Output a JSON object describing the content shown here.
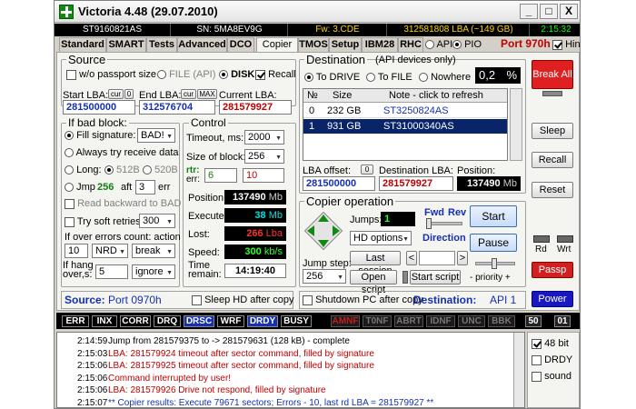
{
  "window": {
    "title": "Victoria 4.48 (29.07.2010)",
    "minimize": "_",
    "maximize": "□",
    "close": "X"
  },
  "info": {
    "model": "ST9160821AS",
    "serial": "SN: 5MA8EV9G",
    "firmware": "Fw: 3.CDE",
    "lba": "312581808 LBA (~149 GB)",
    "time": "2:15:32"
  },
  "tabs": [
    "Standard",
    "SMART",
    "Tests",
    "Advanced",
    "DCO",
    "Copier",
    "TMOS",
    "Setup",
    "IBM28",
    "RHC"
  ],
  "mode": {
    "api": "API",
    "pio": "PIO",
    "port": "Port 970h",
    "hints": "Hints"
  },
  "source": {
    "title": "Source",
    "passport": "w/o passport size",
    "file_api": "FILE (API)",
    "disk": "DISK",
    "recall": "Recall",
    "start_lba_label": "Start LBA:",
    "start_lba_btn": "cur",
    "start_lba_zero": "0",
    "start_lba": "281500000",
    "end_lba_label": "End LBA:",
    "end_lba_btn": "cur",
    "end_lba_max": "MAX",
    "end_lba": "312576704",
    "current_lba_label": "Current LBA:",
    "current_lba": "281579927"
  },
  "badblock": {
    "title": "If bad block:",
    "fill_signature": "Fill signature:",
    "signature": "BAD!",
    "always_try": "Always try receive data",
    "long": "Long:",
    "opt512": "512B",
    "opt520": "520B",
    "jmp": "Jmp",
    "jmp_val": "256",
    "aft": "aft",
    "aft_val": "3",
    "err": "err",
    "read_backward": "Read backward to BAD",
    "try_soft": "Try soft retries",
    "soft_val": "300",
    "over_errors": "If over errors count: action",
    "err_count": "10",
    "nrd": "NRD",
    "break": "break",
    "hang_label": "If hang over,s:",
    "hang_val": "5",
    "ignore": "ignore"
  },
  "control": {
    "title": "Control",
    "timeout_label": "Timeout, ms:",
    "timeout": "2000",
    "block_label": "Size of block:",
    "block": "256",
    "rtr_label": "rtr:",
    "rtr": "6",
    "err_label": "err:",
    "err": "10",
    "position_label": "Position:",
    "position": "137490",
    "position_unit": "Mb",
    "execute_label": "Execute",
    "execute": "38",
    "execute_unit": "Mb",
    "lost_label": "Lost:",
    "lost": "266",
    "lost_unit": "Lba",
    "speed_label": "Speed:",
    "speed": "300",
    "speed_unit": "kb/s",
    "time_label": "Time remain:",
    "time": "14:19:40"
  },
  "destination": {
    "title": "Destination",
    "subtitle": "(API devices only)",
    "to_drive": "To DRIVE",
    "to_file": "To FILE",
    "nowhere": "Nowhere",
    "percent": "0,2",
    "percent_sign": "%",
    "columns": [
      "№",
      "Size",
      "Note - click to refresh"
    ],
    "rows": [
      {
        "n": "0",
        "size": "232 GB",
        "note": "ST3250824AS"
      },
      {
        "n": "1",
        "size": "931 GB",
        "note": "ST31000340AS"
      }
    ],
    "lba_offset_label": "LBA offset:",
    "lba_offset_btn": "0",
    "lba_offset": "281500000",
    "dest_lba_label": "Destination LBA:",
    "dest_lba": "281579927",
    "position_label": "Position:",
    "position": "137490",
    "position_unit": "Mb"
  },
  "copier": {
    "title": "Copier operation",
    "jumps_label": "Jumps:",
    "jumps": "1",
    "fwd": "Fwd",
    "rev": "Rev",
    "direction": "Direction",
    "hd_options": "HD options",
    "last_session": "Last session",
    "jump_step_label": "Jump step:",
    "jump_step": "256",
    "open_script": "Open script",
    "start_script": "Start script",
    "priority": "- priority +",
    "start": "Start",
    "pause": "Pause"
  },
  "bottom": {
    "source_label": "Source:",
    "source_port": "Port 0970h",
    "sleep_hd": "Sleep HD after copy",
    "shutdown": "Shutdown PC after copy",
    "dest_label": "Destination:",
    "dest_api": "API 1"
  },
  "side": {
    "break_all": "Break All",
    "sleep": "Sleep",
    "recall": "Recall",
    "reset": "Reset",
    "rd": "Rd",
    "wrt": "Wrt",
    "passp": "Passp",
    "power": "Power"
  },
  "flags": [
    {
      "label": "ERR",
      "on": true
    },
    {
      "label": "INX",
      "on": true
    },
    {
      "label": "CORR",
      "on": true
    },
    {
      "label": "DRQ",
      "on": true
    },
    {
      "label": "DRSC",
      "on": true,
      "blue": true
    },
    {
      "label": "WRF",
      "on": true
    },
    {
      "label": "DRDY",
      "on": true,
      "blue": true
    },
    {
      "label": "BUSY",
      "on": true
    },
    {
      "label": "AMNF",
      "on": false,
      "red": true
    },
    {
      "label": "T0NF",
      "on": false
    },
    {
      "label": "ABRT",
      "on": false
    },
    {
      "label": "IDNF",
      "on": false
    },
    {
      "label": "UNC",
      "on": false
    },
    {
      "label": "BBK",
      "on": false
    }
  ],
  "counters": {
    "left": "50",
    "right": "01"
  },
  "log": [
    {
      "time": "2:14:59",
      "msg": "Jump from 281579375 to -> 281579631 (128 kB) - complete",
      "color": "#000000"
    },
    {
      "time": "2:15:03",
      "msg": "LBA: 281579924 timeout after sector command, filled by signature",
      "color": "#c00000"
    },
    {
      "time": "2:15:06",
      "msg": "LBA: 281579925 timeout after sector command, filled by signature",
      "color": "#c00000"
    },
    {
      "time": "2:15:06",
      "msg": "Command interrupted by user!",
      "color": "#c00000"
    },
    {
      "time": "2:15:06",
      "msg": "LBA: 281579926 Drive not respond, filled by signature",
      "color": "#c00000"
    },
    {
      "time": "2:15:07",
      "msg": "** Copier results: Execute 79671 sectors; Errors - 10, last rd LBA = 281579927 **",
      "color": "#1530b0"
    }
  ],
  "log_options": {
    "bit48": "48 bit",
    "drdy": "DRDY",
    "sound": "sound"
  }
}
